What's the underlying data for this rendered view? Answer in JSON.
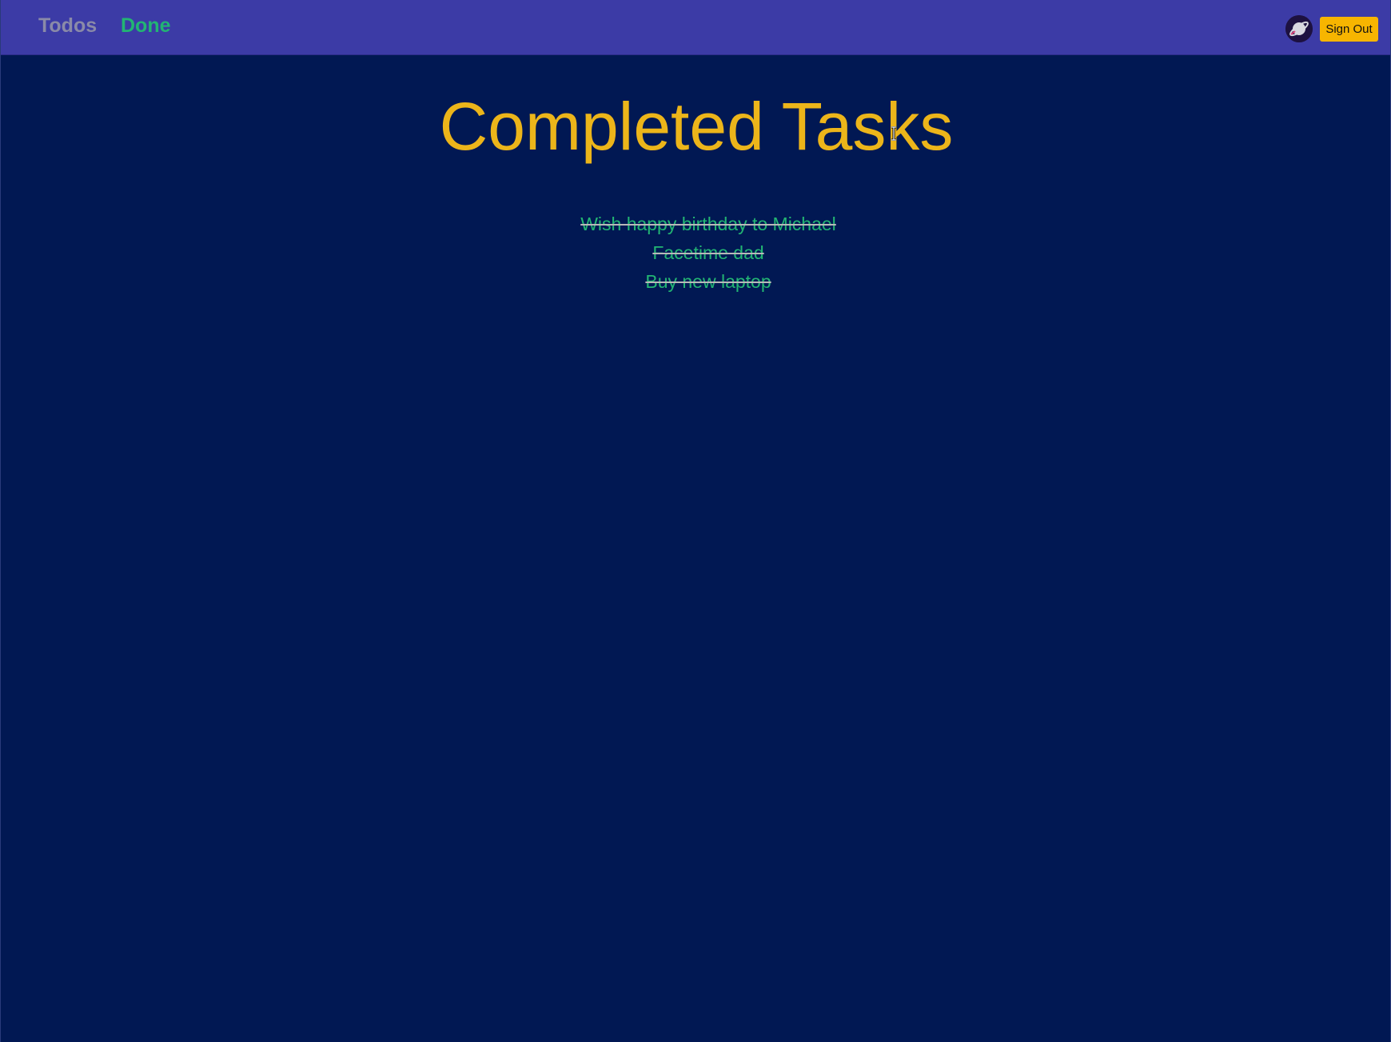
{
  "nav": {
    "todos_label": "Todos",
    "done_label": "Done",
    "signout_label": "Sign Out",
    "avatar_icon": "planet-icon"
  },
  "main": {
    "title": "Completed Tasks",
    "tasks": [
      {
        "label": "Wish happy birthday to Michael"
      },
      {
        "label": "Facetime dad"
      },
      {
        "label": "Buy new laptop"
      }
    ]
  },
  "colors": {
    "background": "#011853",
    "navbar": "#3c3ba6",
    "title": "#ecb51a",
    "task_text": "#22b573",
    "active_nav": "#22b573",
    "inactive_nav": "#8a8aa8",
    "button": "#f7b500"
  }
}
